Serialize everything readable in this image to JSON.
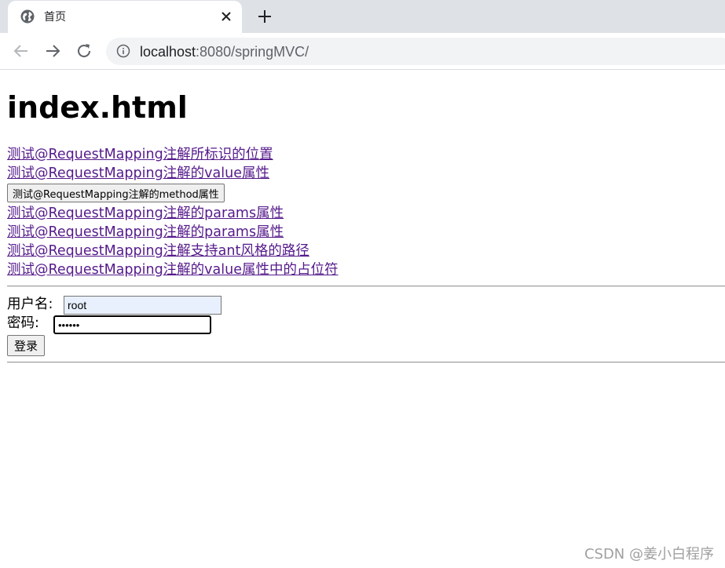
{
  "browser": {
    "tab_title": "首页",
    "url_host": "localhost",
    "url_rest": ":8080/springMVC/"
  },
  "icons": {
    "globe": "globe-icon",
    "close": "close-icon",
    "new_tab": "plus-icon",
    "back": "back-arrow-icon",
    "forward": "forward-arrow-icon",
    "reload": "reload-icon",
    "site_info": "info-icon"
  },
  "page": {
    "heading": "index.html",
    "links": [
      "测试@RequestMapping注解所标识的位置",
      "测试@RequestMapping注解的value属性"
    ],
    "method_button_label": "测试@RequestMapping注解的method属性",
    "links_after": [
      "测试@RequestMapping注解的params属性",
      "测试@RequestMapping注解的params属性",
      "测试@RequestMapping注解支持ant风格的路径",
      "测试@RequestMapping注解的value属性中的占位符"
    ],
    "form": {
      "username_label": "用户名:",
      "username_value": "root",
      "password_label": "密码:",
      "password_value": "123456",
      "login_label": "登录"
    },
    "watermark": "CSDN @姜小白程序"
  },
  "colors": {
    "link_visited": "#551a8b",
    "autofill_bg": "#e8f0fe",
    "chrome_bg": "#dee1e6"
  }
}
